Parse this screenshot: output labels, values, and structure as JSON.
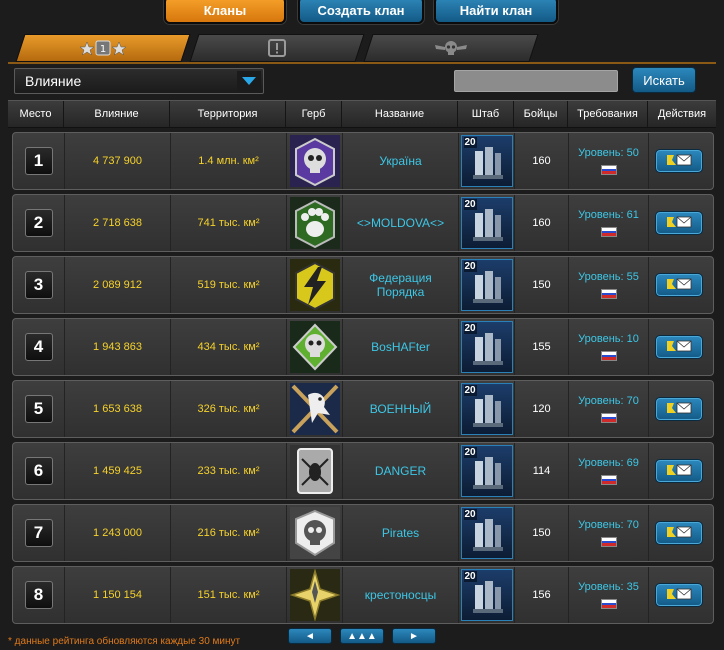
{
  "top_buttons": {
    "clans": "Кланы",
    "create_clan": "Создать клан",
    "find_clan": "Найти клан"
  },
  "tabs": [
    {
      "icon": "stars-icon",
      "active": true
    },
    {
      "icon": "alert-icon",
      "active": false
    },
    {
      "icon": "skull-wings-icon",
      "active": false
    }
  ],
  "filter": {
    "selected": "Влияние",
    "search_placeholder": "",
    "search_button": "Искать"
  },
  "columns": {
    "place": "Место",
    "influence": "Влияние",
    "territory": "Территория",
    "emblem": "Герб",
    "name": "Название",
    "hq": "Штаб",
    "fighters": "Бойцы",
    "requirements": "Требования",
    "actions": "Действия"
  },
  "rows": [
    {
      "place": "1",
      "influence": "4 737 900",
      "territory": "1.4 млн. км²",
      "emblem": "skull-purple-emblem",
      "name": "Україна",
      "hq_level": "20",
      "fighters": "160",
      "requirement": "Уровень: 50"
    },
    {
      "place": "2",
      "influence": "2 718 638",
      "territory": "741 тыс. км²",
      "emblem": "paw-green-emblem",
      "name": "<>MOLDOVA<>",
      "hq_level": "20",
      "fighters": "160",
      "requirement": "Уровень: 61"
    },
    {
      "place": "3",
      "influence": "2 089 912",
      "territory": "519 тыс. км²",
      "emblem": "lightning-yellow-emblem",
      "name": "Федерация Порядка",
      "hq_level": "20",
      "fighters": "150",
      "requirement": "Уровень: 55"
    },
    {
      "place": "4",
      "influence": "1 943 863",
      "territory": "434 тыс. км²",
      "emblem": "skull-green-emblem",
      "name": "BosHAFter",
      "hq_level": "20",
      "fighters": "155",
      "requirement": "Уровень: 10"
    },
    {
      "place": "5",
      "influence": "1 653 638",
      "territory": "326 тыс. км²",
      "emblem": "eagle-blue-emblem",
      "name": "ВОЕННЫЙ",
      "hq_level": "20",
      "fighters": "120",
      "requirement": "Уровень: 70"
    },
    {
      "place": "6",
      "influence": "1 459 425",
      "territory": "233 тыс. км²",
      "emblem": "spider-silver-emblem",
      "name": "DANGER",
      "hq_level": "20",
      "fighters": "114",
      "requirement": "Уровень: 69"
    },
    {
      "place": "7",
      "influence": "1 243 000",
      "territory": "216 тыс. км²",
      "emblem": "skull-silver-emblem",
      "name": "Pirates",
      "hq_level": "20",
      "fighters": "150",
      "requirement": "Уровень: 70"
    },
    {
      "place": "8",
      "influence": "1 150 154",
      "territory": "151 тыс. км²",
      "emblem": "star-gold-emblem",
      "name": "крестоносцы",
      "hq_level": "20",
      "fighters": "156",
      "requirement": "Уровень: 35"
    }
  ],
  "footer": {
    "note": "* данные рейтинга обновляются каждые 30 минут",
    "prev": "◄",
    "up": "▲▲▲",
    "next": "►"
  },
  "colors": {
    "accent_orange": "#e8901c",
    "accent_blue": "#1f74a8",
    "text_yellow": "#f6d22a",
    "text_cyan": "#3cc7e6"
  }
}
